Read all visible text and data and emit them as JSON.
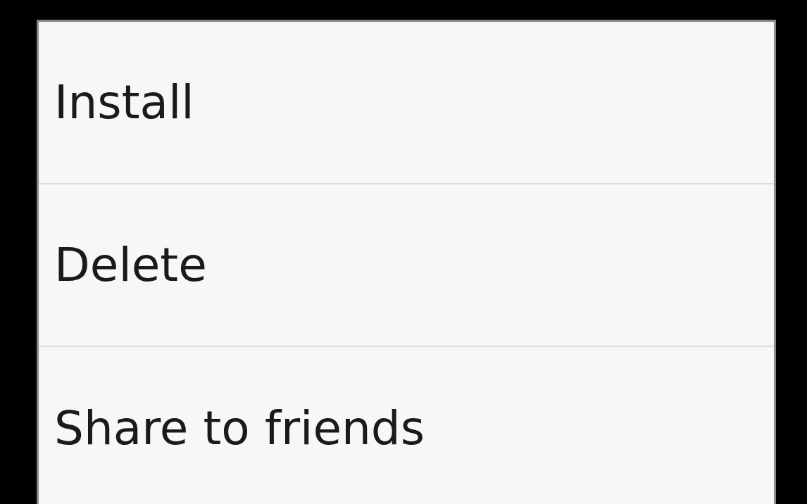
{
  "menu": {
    "items": [
      {
        "label": "Install"
      },
      {
        "label": "Delete"
      },
      {
        "label": "Share to friends"
      }
    ]
  }
}
